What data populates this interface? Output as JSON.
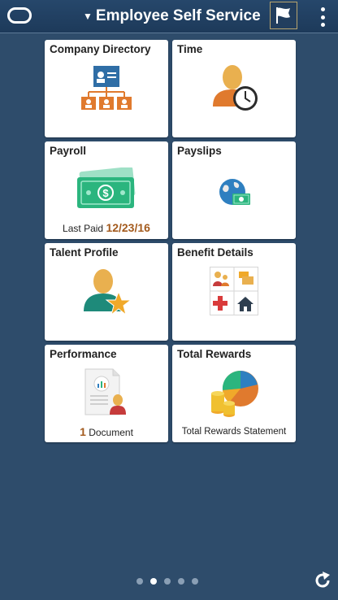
{
  "header": {
    "title": "Employee Self Service",
    "caret": "▼"
  },
  "tiles": [
    {
      "title": "Company Directory",
      "icon": "org-chart-icon"
    },
    {
      "title": "Time",
      "icon": "employee-clock-icon"
    },
    {
      "title": "Payroll",
      "icon": "money-icon",
      "footer_label": "Last Paid",
      "footer_value": "12/23/16"
    },
    {
      "title": "Payslips",
      "icon": "globe-money-icon"
    },
    {
      "title": "Talent Profile",
      "icon": "person-star-icon"
    },
    {
      "title": "Benefit Details",
      "icon": "benefits-grid-icon"
    },
    {
      "title": "Performance",
      "icon": "document-person-icon",
      "footer_count": "1",
      "footer_label": "Document"
    },
    {
      "title": "Total Rewards",
      "icon": "pie-coins-icon",
      "footer_label": "Total Rewards Statement"
    }
  ],
  "pager": {
    "pages": 5,
    "active_page": 2
  },
  "colors": {
    "background": "#2e4c6b",
    "header": "#1f3d5e",
    "tile": "#ffffff",
    "accent_orange": "#e07a2e",
    "money_green": "#2bb57e",
    "date_brown": "#a35a1d"
  }
}
